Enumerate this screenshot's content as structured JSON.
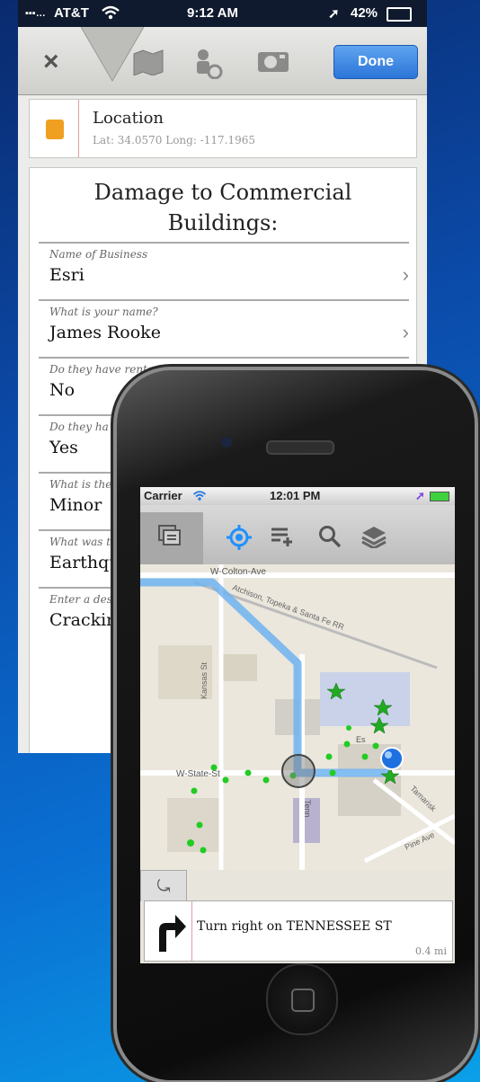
{
  "back_screen": {
    "status": {
      "carrier": "AT&T",
      "time": "9:12 AM",
      "battery": "42%"
    },
    "toolbar": {
      "close_label": "×",
      "done_label": "Done"
    },
    "location": {
      "title": "Location",
      "coords": "Lat: 34.0570 Long: -117.1965"
    },
    "form": {
      "title": "Damage to Commercial Buildings:",
      "fields": [
        {
          "label": "Name of Business",
          "value": "Esri"
        },
        {
          "label": "What is your name?",
          "value": "James Rooke"
        },
        {
          "label": "Do they have renters insurance?",
          "value": "No"
        },
        {
          "label": "Do they ha",
          "value": "Yes"
        },
        {
          "label": "What is the",
          "value": "Minor"
        },
        {
          "label": "What was t",
          "value": "Earthqu"
        },
        {
          "label": "Enter a des",
          "value": "Cracking"
        }
      ]
    }
  },
  "front_screen": {
    "status": {
      "carrier": "Carrier",
      "time": "12:01 PM"
    },
    "map_labels": {
      "colton": "W-Colton-Ave",
      "atchison": "Atchison, Topeka & Santa Fe RR",
      "kansas": "Kansas St",
      "state": "W-State-St",
      "tenn": "Tenn",
      "tamarisk": "Tamarisk",
      "pine": "Pine Ave",
      "es": "Es"
    },
    "nav_tab_label": "⤿",
    "direction": {
      "text": "Turn right on TENNESSEE ST",
      "distance": "0.4 mi"
    }
  },
  "colors": {
    "route": "#6fb3f0",
    "done_button": "#2b75d8",
    "marker_green": "#22cc22",
    "location_dot": "#1e6fe0"
  },
  "icons": [
    "close-icon",
    "map-icon",
    "person-location-icon",
    "camera-icon",
    "layers-list-icon",
    "locate-icon",
    "add-note-icon",
    "search-icon",
    "layers-icon",
    "turn-right-icon",
    "uturn-icon",
    "wifi-icon",
    "location-arrow-icon",
    "battery-icon"
  ]
}
